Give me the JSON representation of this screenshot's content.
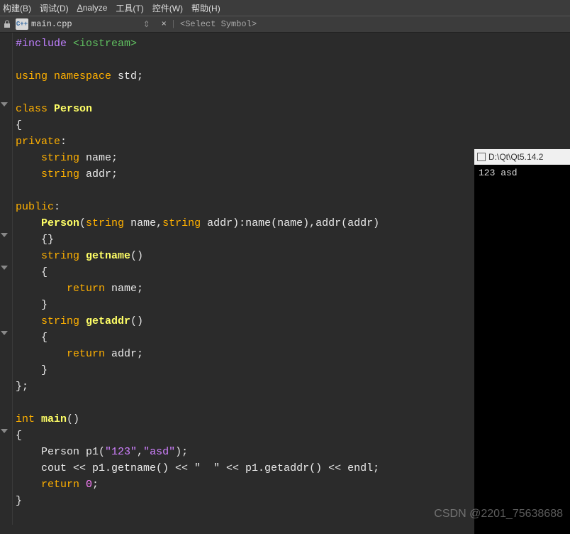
{
  "menubar": {
    "build": "构建(B)",
    "debug": "调试(D)",
    "analyze": "Analyze",
    "tools": "工具(T)",
    "widgets": "控件(W)",
    "help": "帮助(H)"
  },
  "toolbar": {
    "cpp_icon": "C++",
    "filename": "main.cpp",
    "dropdown": "⇕",
    "close": "×",
    "vsep": "|",
    "symbol_placeholder": "<Select Symbol>"
  },
  "code": {
    "l1_a": "#include ",
    "l1_b": "<iostream>",
    "l3_a": "using ",
    "l3_b": "namespace ",
    "l3_c": "std",
    "l3_d": ";",
    "l5_a": "class ",
    "l5_b": "Person",
    "l6": "{",
    "l7_a": "private",
    "l7_b": ":",
    "l8_a": "    string ",
    "l8_b": "name",
    "l8_c": ";",
    "l9_a": "    string ",
    "l9_b": "addr",
    "l9_c": ";",
    "l11_a": "public",
    "l11_b": ":",
    "l12_a": "    ",
    "l12_b": "Person",
    "l12_c": "(",
    "l12_d": "string ",
    "l12_e": "name,",
    "l12_f": "string ",
    "l12_g": "addr):name(name),addr(addr)",
    "l13": "    {}",
    "l14_a": "    string ",
    "l14_b": "getname",
    "l14_c": "()",
    "l15": "    {",
    "l16_a": "        ",
    "l16_b": "return ",
    "l16_c": "name;",
    "l17": "    }",
    "l18_a": "    string ",
    "l18_b": "getaddr",
    "l18_c": "()",
    "l19": "    {",
    "l20_a": "        ",
    "l20_b": "return ",
    "l20_c": "addr;",
    "l21": "    }",
    "l22": "};",
    "l24_a": "int ",
    "l24_b": "main",
    "l24_c": "()",
    "l25": "{",
    "l26_a": "    Person p1(",
    "l26_b": "\"123\"",
    "l26_c": ",",
    "l26_d": "\"asd\"",
    "l26_e": ");",
    "l27": "    cout << p1.getname() << \"  \" << p1.getaddr() << endl;",
    "l28_a": "    ",
    "l28_b": "return ",
    "l28_c": "0",
    "l28_d": ";",
    "l29": "}"
  },
  "console": {
    "title": "D:\\Qt\\Qt5.14.2",
    "output": "123  asd"
  },
  "watermark": "CSDN @2201_75638688",
  "fold_positions": [
    96,
    280,
    326,
    418,
    556
  ]
}
